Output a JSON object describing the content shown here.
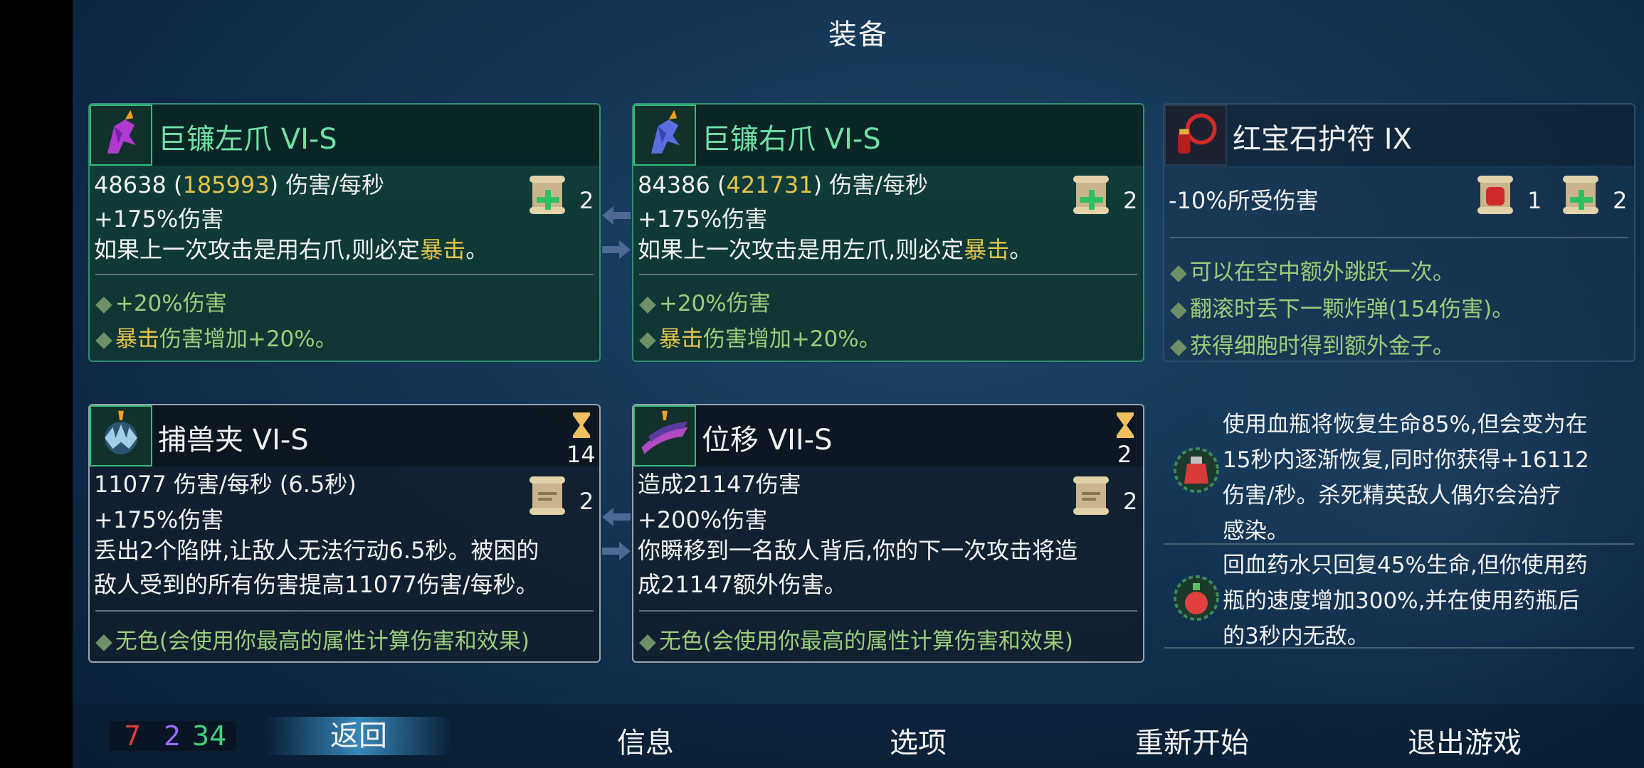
{
  "title": "装备",
  "colors": {
    "green_name": "#6fe0a6",
    "gold": "#e6c44a",
    "bullet": "#9acd7a",
    "cells_red": "#e03a3a",
    "cells_purple": "#9b6bff",
    "cells_green": "#3fd07a"
  },
  "weapons": [
    {
      "name": "巨镰左爪 VI-S",
      "icon": "left-claw-icon",
      "dps": "48638",
      "dps_bonus": "185993",
      "dps_unit": "伤害/每秒",
      "dmg_bonus": "+175%伤害",
      "scroll_count": "2",
      "desc_pre": "如果上一次攻击是用右爪,则必定",
      "desc_hl": "暴击",
      "desc_post": "。",
      "b1": "+20%伤害",
      "b2_hl": "暴击",
      "b2_post": "伤害增加+20%。"
    },
    {
      "name": "巨镰右爪 VI-S",
      "icon": "right-claw-icon",
      "dps": "84386",
      "dps_bonus": "421731",
      "dps_unit": "伤害/每秒",
      "dmg_bonus": "+175%伤害",
      "scroll_count": "2",
      "desc_pre": "如果上一次攻击是用左爪,则必定",
      "desc_hl": "暴击",
      "desc_post": "。",
      "b1": "+20%伤害",
      "b2_hl": "暴击",
      "b2_post": "伤害增加+20%。"
    }
  ],
  "amulet": {
    "name": "红宝石护符 IX",
    "icon": "ruby-amulet-icon",
    "stat": "-10%所受伤害",
    "fist_count": "1",
    "scroll_count": "2",
    "bullets": [
      "可以在空中额外跳跃一次。",
      "翻滚时丢下一颗炸弹(154伤害)。",
      "获得细胞时得到额外金子。"
    ]
  },
  "skills": [
    {
      "name": "捕兽夹 VI-S",
      "icon": "bear-trap-icon",
      "cooldown": "14",
      "stat": "11077 伤害/每秒 (6.5秒)",
      "dmg_bonus": "+175%伤害",
      "scroll_count": "2",
      "desc1": "丢出2个陷阱,让敌人无法行动6.5秒。被困的",
      "desc2": "敌人受到的所有伤害提高11077伤害/每秒。",
      "bullet": "无色(会使用你最高的属性计算伤害和效果)"
    },
    {
      "name": "位移 VII-S",
      "icon": "phaser-icon",
      "cooldown": "2",
      "stat": "造成21147伤害",
      "dmg_bonus": "+200%伤害",
      "scroll_count": "2",
      "desc1": "你瞬移到一名敌人背后,你的下一次攻击将造",
      "desc2": "成21147额外伤害。",
      "bullet": "无色(会使用你最高的属性计算伤害和效果)"
    }
  ],
  "mutations": [
    {
      "icon": "health-flask-icon",
      "lines": [
        "使用血瓶将恢复生命85%,但会变为在",
        "15秒内逐渐恢复,同时你获得+16112",
        "伤害/秒。杀死精英敌人偶尔会治疗",
        "感染。"
      ]
    },
    {
      "icon": "potion-icon",
      "lines": [
        "回血药水只回复45%生命,但你使用药",
        "瓶的速度增加300%,并在使用药瓶后",
        "的3秒内无敌。"
      ]
    }
  ],
  "cells": {
    "red": "7",
    "purple": "2",
    "green": "34"
  },
  "nav": {
    "back": "返回",
    "info": "信息",
    "options": "选项",
    "restart": "重新开始",
    "quit": "退出游戏"
  }
}
